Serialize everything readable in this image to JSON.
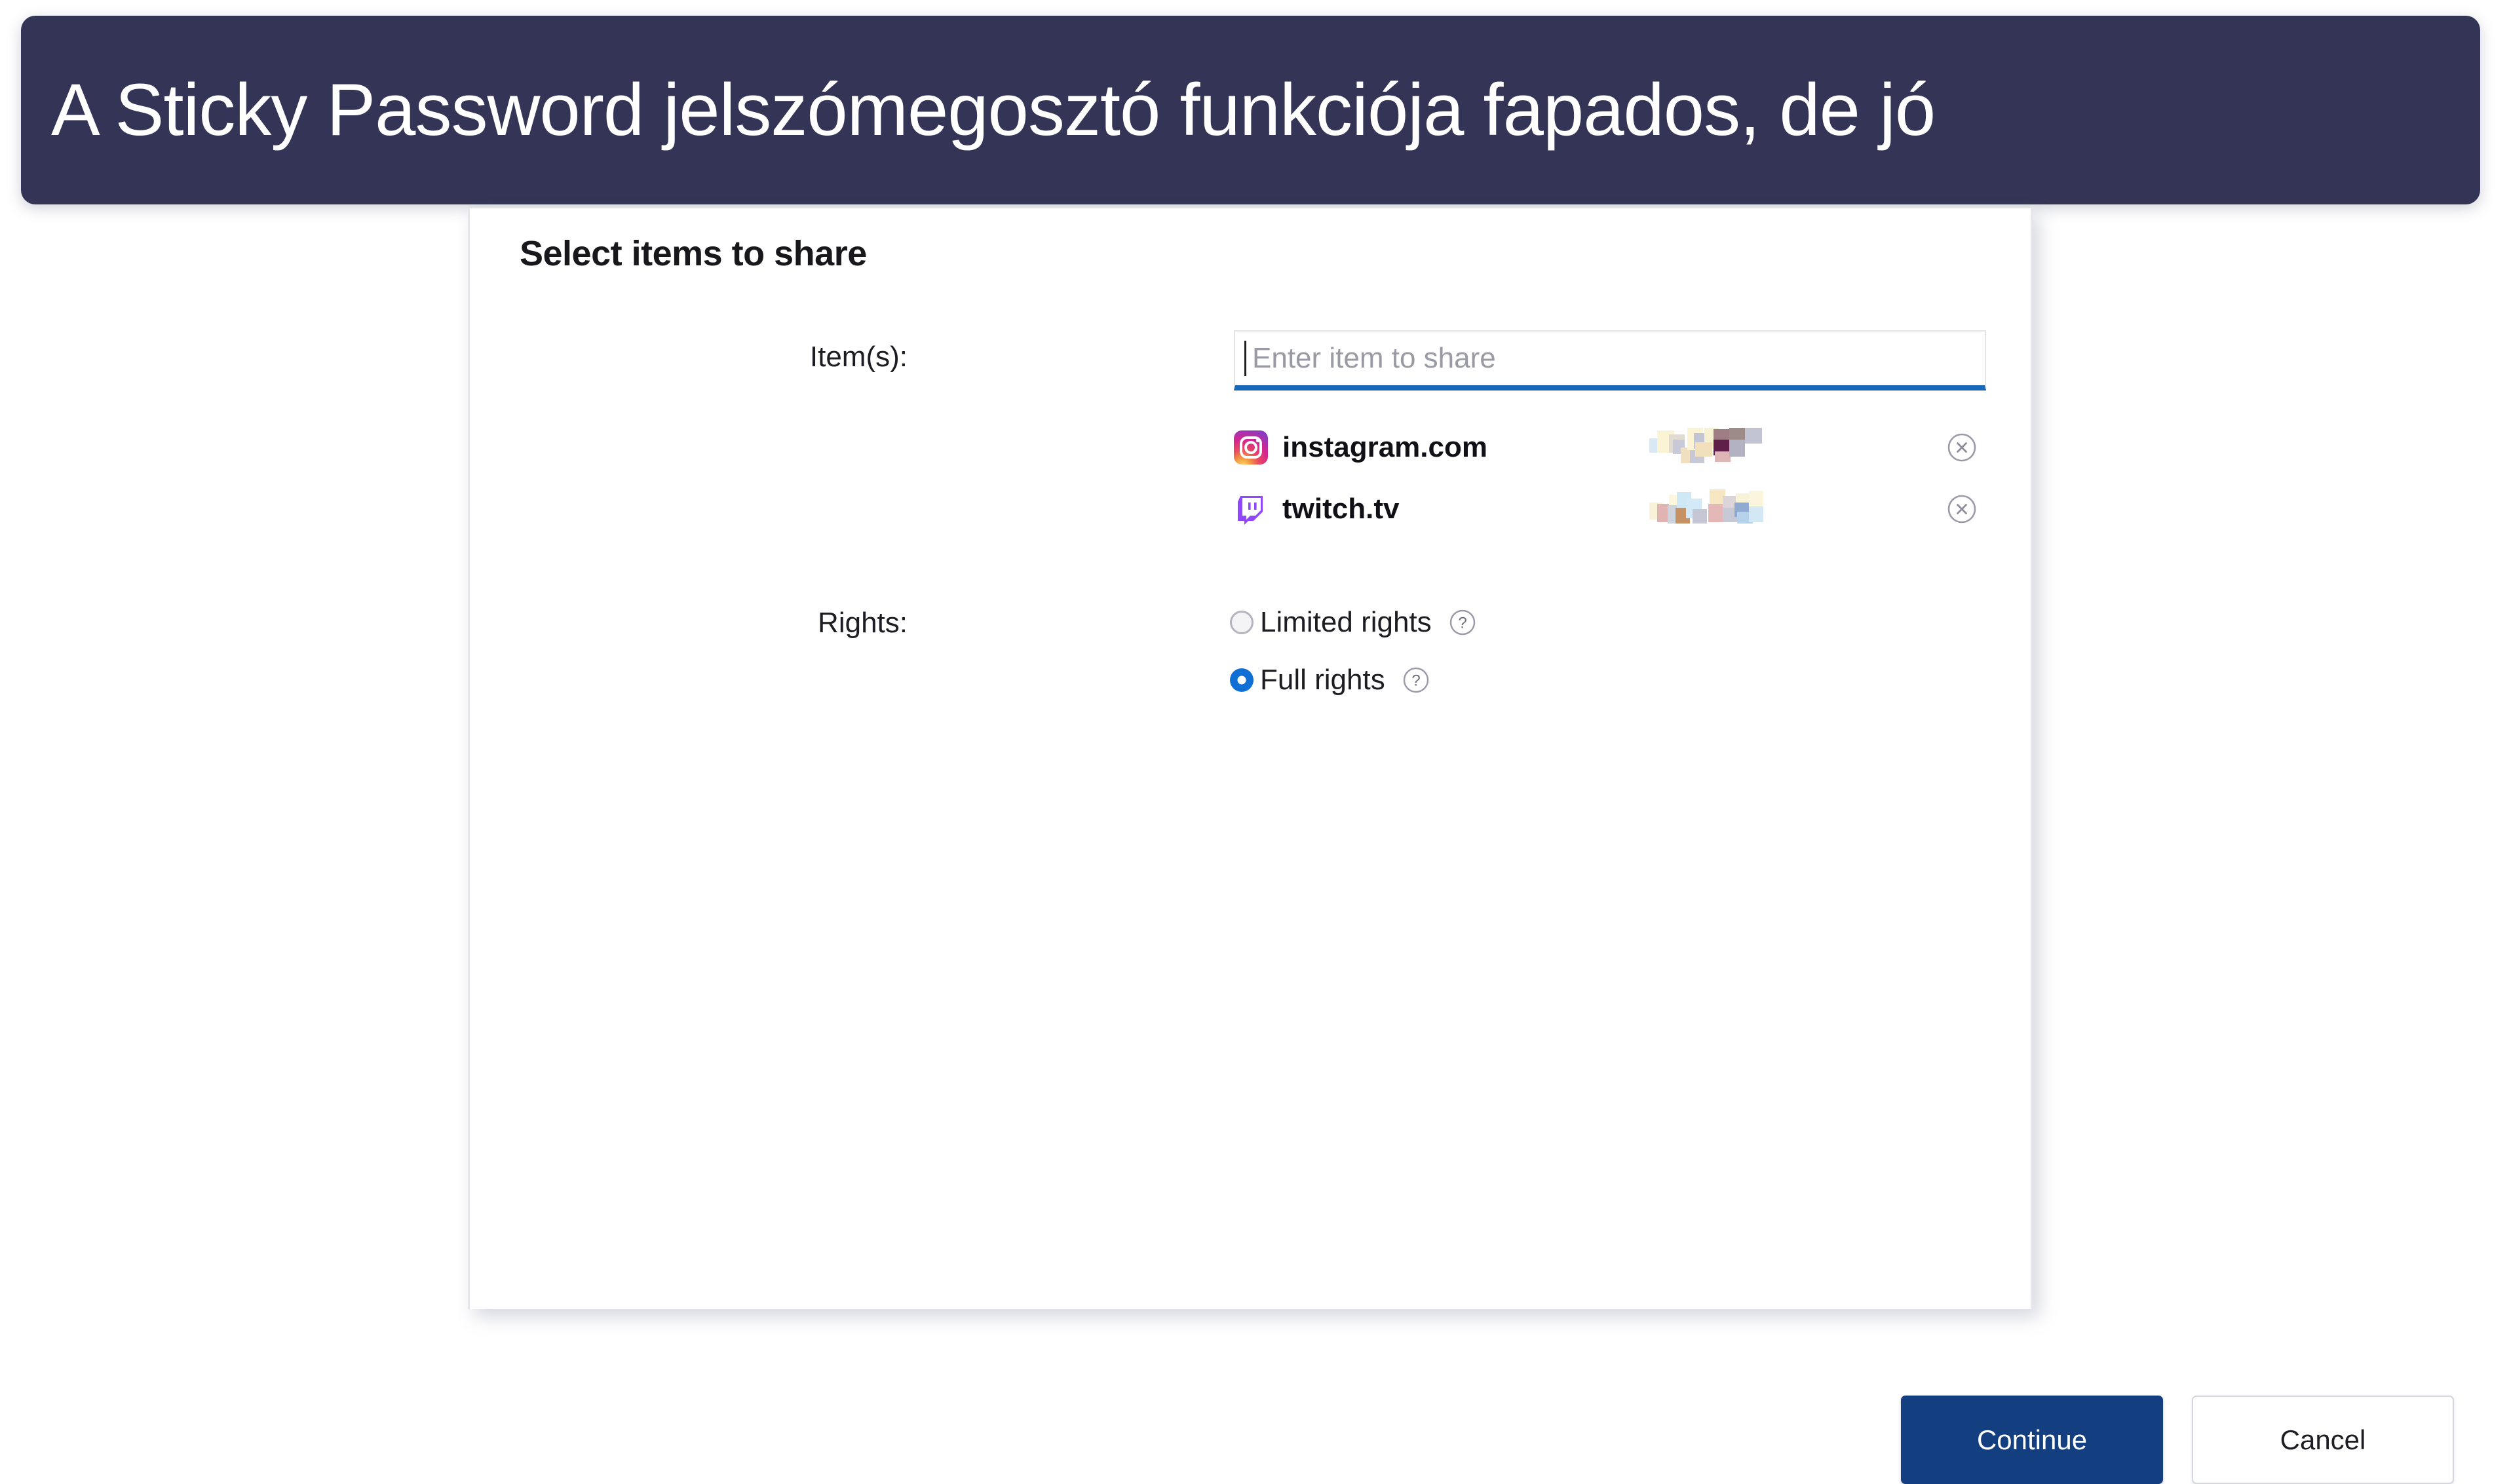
{
  "banner": {
    "title": "A Sticky Password jelszómegosztó funkciója fapados, de jó",
    "background_color": "#343556",
    "text_color": "#ffffff"
  },
  "dialog": {
    "title": "Select items to share",
    "items_field": {
      "label": "Item(s):",
      "value": "",
      "placeholder": "Enter item to share",
      "focus_color": "#1868b8"
    },
    "shared_items": [
      {
        "icon": "instagram-icon",
        "name": "instagram.com",
        "account": "",
        "account_redacted": true,
        "remove_icon": "circle-x-icon"
      },
      {
        "icon": "twitch-icon",
        "name": "twitch.tv",
        "account": "",
        "account_redacted": true,
        "remove_icon": "circle-x-icon"
      }
    ],
    "rights": {
      "label": "Rights:",
      "options": [
        {
          "label": "Limited rights",
          "selected": false,
          "help_icon": "question-mark-icon"
        },
        {
          "label": "Full rights",
          "selected": true,
          "help_icon": "question-mark-icon"
        }
      ],
      "selected_color": "#0f6fd4"
    },
    "footer": {
      "primary_label": "Continue",
      "primary_color": "#133e80",
      "secondary_label": "Cancel"
    }
  }
}
